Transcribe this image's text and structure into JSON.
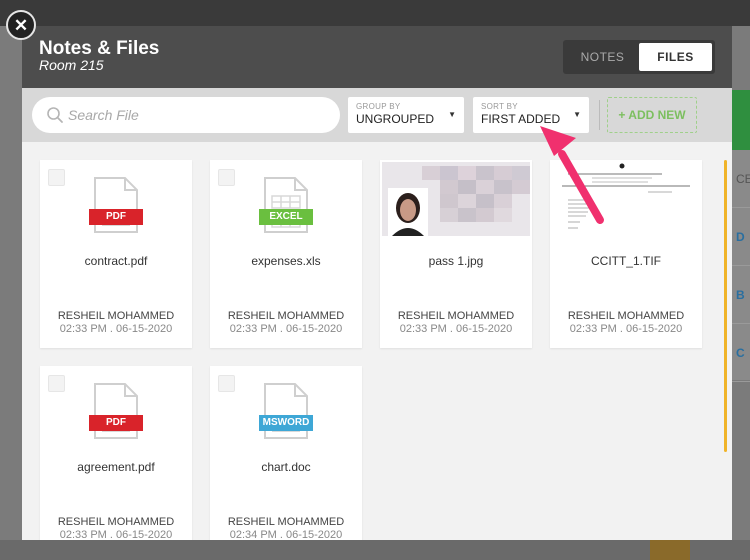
{
  "modal": {
    "title": "Notes & Files",
    "subtitle": "Room 215"
  },
  "view_toggle": {
    "notes_label": "NOTES",
    "files_label": "FILES",
    "active": "FILES"
  },
  "toolbar": {
    "search_placeholder": "Search File",
    "group_by": {
      "label": "GROUP BY",
      "value": "UNGROUPED"
    },
    "sort_by": {
      "label": "SORT BY",
      "value": "FIRST ADDED"
    },
    "add_new_label": "+ ADD NEW"
  },
  "files": [
    {
      "name": "contract.pdf",
      "badge": "PDF",
      "badge_color": "#d9232a",
      "icon": "document-icon",
      "owner": "RESHEIL MOHAMMED",
      "date": "02:33 PM . 06-15-2020"
    },
    {
      "name": "expenses.xls",
      "badge": "EXCEL",
      "badge_color": "#6abf3f",
      "icon": "spreadsheet-icon",
      "owner": "RESHEIL MOHAMMED",
      "date": "02:33 PM . 06-15-2020"
    },
    {
      "name": "pass 1.jpg",
      "thumbnail": "passport-photo",
      "owner": "RESHEIL MOHAMMED",
      "date": "02:33 PM . 06-15-2020"
    },
    {
      "name": "CCITT_1.TIF",
      "thumbnail": "scanned-letter",
      "owner": "RESHEIL MOHAMMED",
      "date": "02:33 PM . 06-15-2020"
    },
    {
      "name": "agreement.pdf",
      "badge": "PDF",
      "badge_color": "#d9232a",
      "icon": "document-icon",
      "owner": "RESHEIL MOHAMMED",
      "date": "02:33 PM . 06-15-2020"
    },
    {
      "name": "chart.doc",
      "badge": "MSWORD",
      "badge_color": "#3ea7d6",
      "icon": "document-icon",
      "owner": "RESHEIL MOHAMMED",
      "date": "02:34 PM . 06-15-2020"
    }
  ],
  "background": {
    "side_items": [
      "CE",
      "D",
      "B",
      "C"
    ]
  },
  "colors": {
    "header": "#4d4d4d",
    "accent_scroll": "#f0b429",
    "add_new": "#7cbf5f",
    "annotation_arrow": "#f0306e"
  }
}
